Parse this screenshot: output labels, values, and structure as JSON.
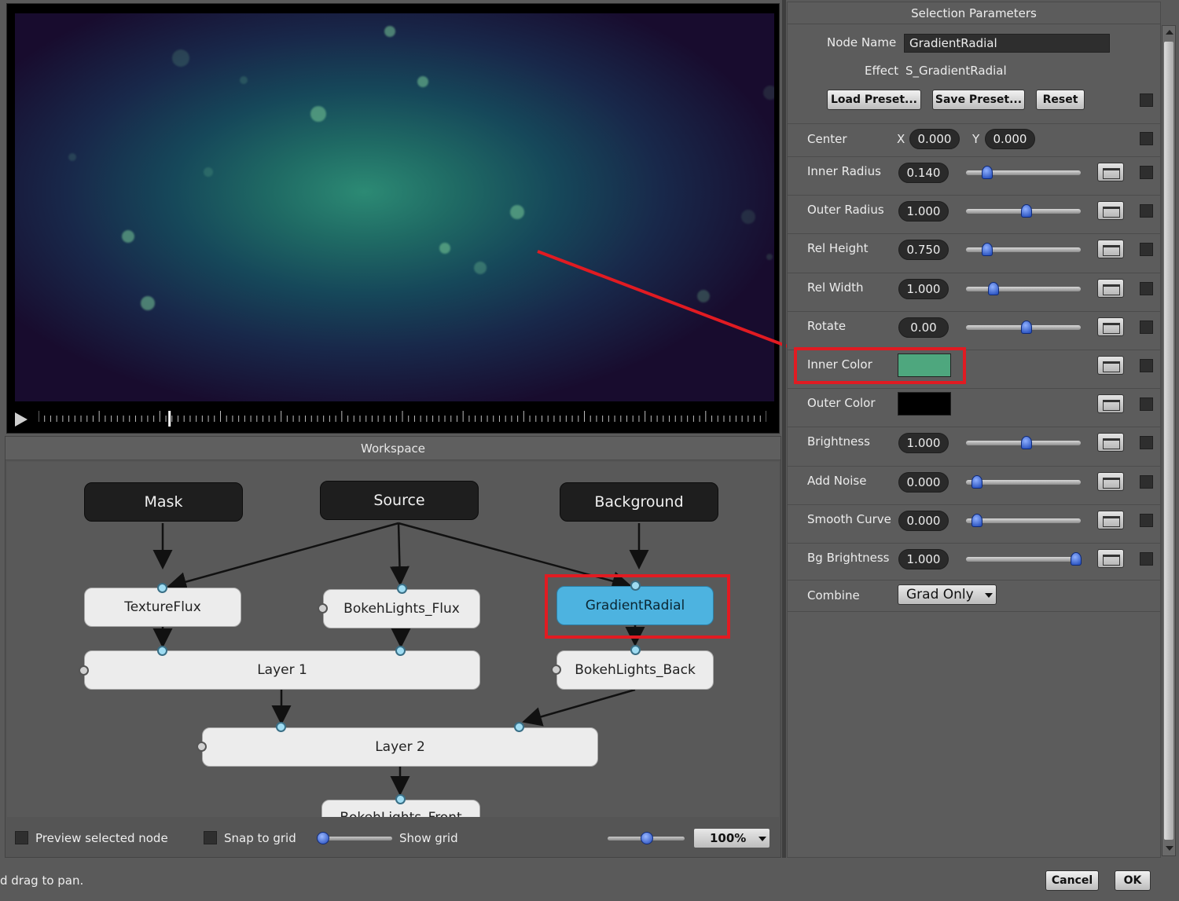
{
  "preview": {
    "timeline_progress": 0.18
  },
  "workspace": {
    "title": "Workspace",
    "nodes": {
      "mask": "Mask",
      "source": "Source",
      "background": "Background",
      "textureflux": "TextureFlux",
      "bokehlights_flux": "BokehLights_Flux",
      "gradientradial": "GradientRadial",
      "layer1": "Layer 1",
      "bokehlights_back": "BokehLights_Back",
      "layer2": "Layer 2",
      "bokehlights_front": "BokehLights_Front"
    },
    "footer": {
      "preview_selected": "Preview selected node",
      "snap_to_grid": "Snap to grid",
      "show_grid": "Show grid",
      "zoom": "100%"
    }
  },
  "status_text": "d drag to pan.",
  "dialog": {
    "cancel": "Cancel",
    "ok": "OK"
  },
  "params": {
    "title": "Selection Parameters",
    "node_name_label": "Node Name",
    "node_name_value": "GradientRadial",
    "effect_label": "Effect",
    "effect_value": "S_GradientRadial",
    "load_preset": "Load Preset...",
    "save_preset": "Save Preset...",
    "reset": "Reset",
    "center_label": "Center",
    "center_x_label": "X",
    "center_x": "0.000",
    "center_y_label": "Y",
    "center_y": "0.000",
    "rows": [
      {
        "label": "Inner Radius",
        "value": "0.140",
        "slider": 0.14
      },
      {
        "label": "Outer Radius",
        "value": "1.000",
        "slider": 0.5
      },
      {
        "label": "Rel Height",
        "value": "0.750",
        "slider": 0.14
      },
      {
        "label": "Rel Width",
        "value": "1.000",
        "slider": 0.2
      },
      {
        "label": "Rotate",
        "value": "0.00",
        "slider": 0.5
      },
      {
        "label": "Inner Color",
        "color": "#4ea77e"
      },
      {
        "label": "Outer Color",
        "color": "#000000"
      },
      {
        "label": "Brightness",
        "value": "1.000",
        "slider": 0.5
      },
      {
        "label": "Add Noise",
        "value": "0.000",
        "slider": 0.05
      },
      {
        "label": "Smooth Curve",
        "value": "0.000",
        "slider": 0.05
      },
      {
        "label": "Bg Brightness",
        "value": "1.000",
        "slider": 0.95
      }
    ],
    "combine_label": "Combine",
    "combine_value": "Grad Only"
  },
  "colors": {
    "highlight": "#e11b22",
    "selected_node": "#4db3e0",
    "inner_color": "#4ea77e",
    "outer_color": "#000000"
  }
}
